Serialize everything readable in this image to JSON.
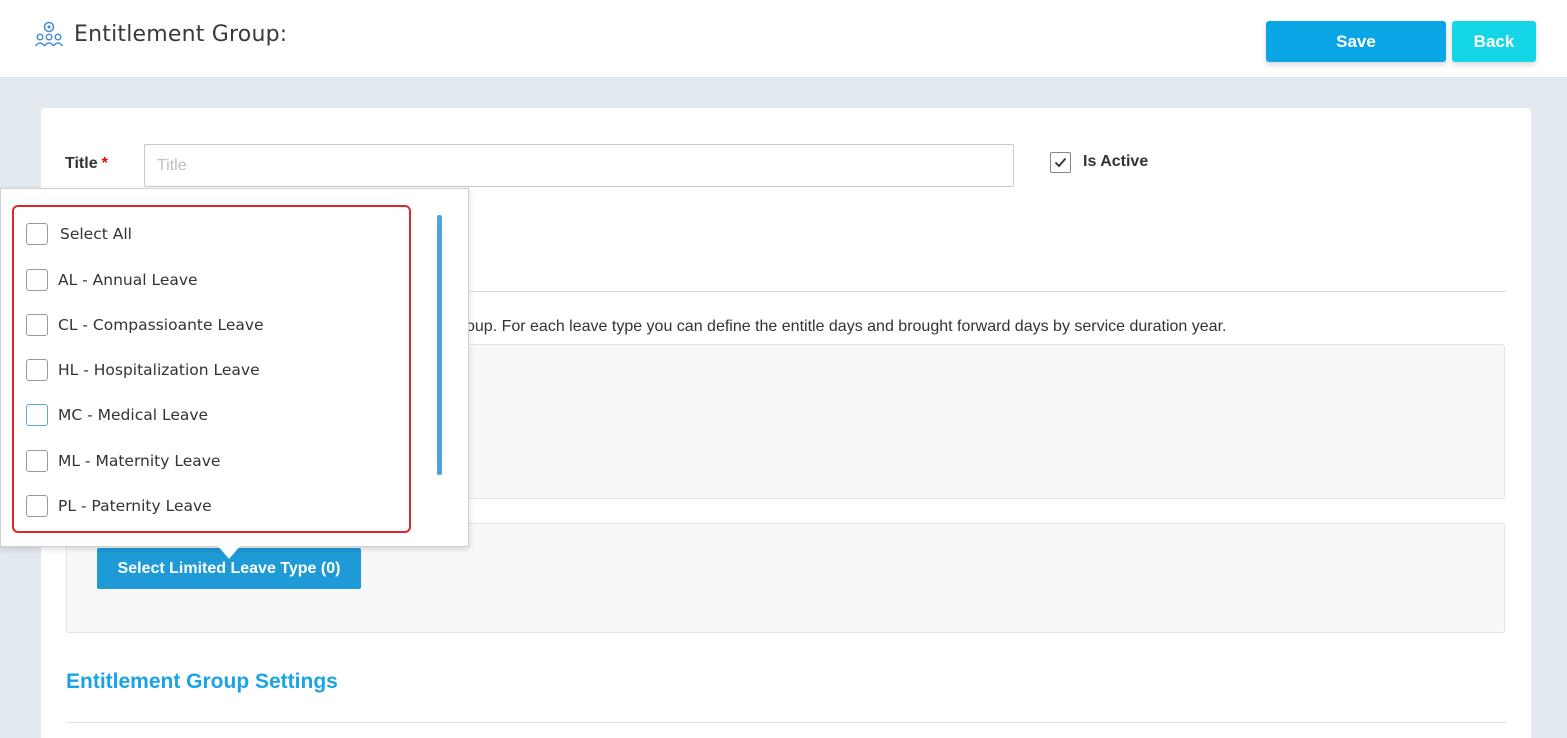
{
  "header": {
    "title": "Entitlement Group:",
    "icon": "user-group-settings-icon",
    "save_label": "Save",
    "back_label": "Back"
  },
  "form": {
    "title_label": "Title",
    "required_mark": "*",
    "title_placeholder": "Title",
    "title_value": "",
    "is_active_label": "Is Active",
    "is_active_checked": true,
    "description": "oup. For each leave type you can define the entitle days and brought forward days by service duration year.",
    "limited_button_label": "Select Limited Leave Type (0)"
  },
  "dropdown": {
    "select_all_label": "Select All",
    "options": [
      {
        "label": "AL - Annual Leave",
        "checked": false
      },
      {
        "label": "CL - Compassioante Leave",
        "checked": false
      },
      {
        "label": "HL - Hospitalization Leave",
        "checked": false
      },
      {
        "label": "MC - Medical Leave",
        "checked": false
      },
      {
        "label": "ML - Maternity Leave",
        "checked": false
      },
      {
        "label": "PL - Paternity Leave",
        "checked": false
      }
    ]
  },
  "settings": {
    "heading": "Entitlement Group Settings"
  },
  "colors": {
    "primary": "#0aa5e5",
    "accent": "#14d6e6",
    "heading": "#1aa3e6",
    "highlight": "#e0262b"
  }
}
